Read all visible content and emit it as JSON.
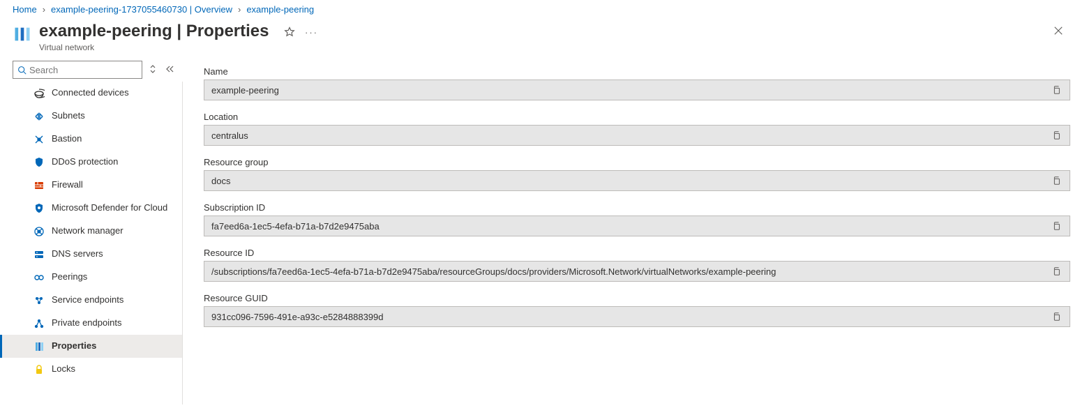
{
  "breadcrumb": [
    {
      "label": "Home"
    },
    {
      "label": "example-peering-1737055460730 | Overview"
    },
    {
      "label": "example-peering"
    }
  ],
  "header": {
    "title": "example-peering | Properties",
    "subtitle": "Virtual network"
  },
  "search": {
    "placeholder": "Search"
  },
  "sidebar": {
    "items": [
      {
        "label": "Connected devices",
        "icon": "devices"
      },
      {
        "label": "Subnets",
        "icon": "subnets"
      },
      {
        "label": "Bastion",
        "icon": "bastion"
      },
      {
        "label": "DDoS protection",
        "icon": "shield"
      },
      {
        "label": "Firewall",
        "icon": "firewall"
      },
      {
        "label": "Microsoft Defender for Cloud",
        "icon": "defender"
      },
      {
        "label": "Network manager",
        "icon": "netmgr"
      },
      {
        "label": "DNS servers",
        "icon": "dns"
      },
      {
        "label": "Peerings",
        "icon": "peerings"
      },
      {
        "label": "Service endpoints",
        "icon": "svcendpoints"
      },
      {
        "label": "Private endpoints",
        "icon": "privendpoints"
      },
      {
        "label": "Properties",
        "icon": "properties",
        "selected": true
      },
      {
        "label": "Locks",
        "icon": "lock"
      }
    ]
  },
  "properties": {
    "fields": [
      {
        "label": "Name",
        "value": "example-peering"
      },
      {
        "label": "Location",
        "value": "centralus"
      },
      {
        "label": "Resource group",
        "value": "docs"
      },
      {
        "label": "Subscription ID",
        "value": "fa7eed6a-1ec5-4efa-b71a-b7d2e9475aba"
      },
      {
        "label": "Resource ID",
        "value": "/subscriptions/fa7eed6a-1ec5-4efa-b71a-b7d2e9475aba/resourceGroups/docs/providers/Microsoft.Network/virtualNetworks/example-peering"
      },
      {
        "label": "Resource GUID",
        "value": "931cc096-7596-491e-a93c-e5284888399d"
      }
    ]
  }
}
